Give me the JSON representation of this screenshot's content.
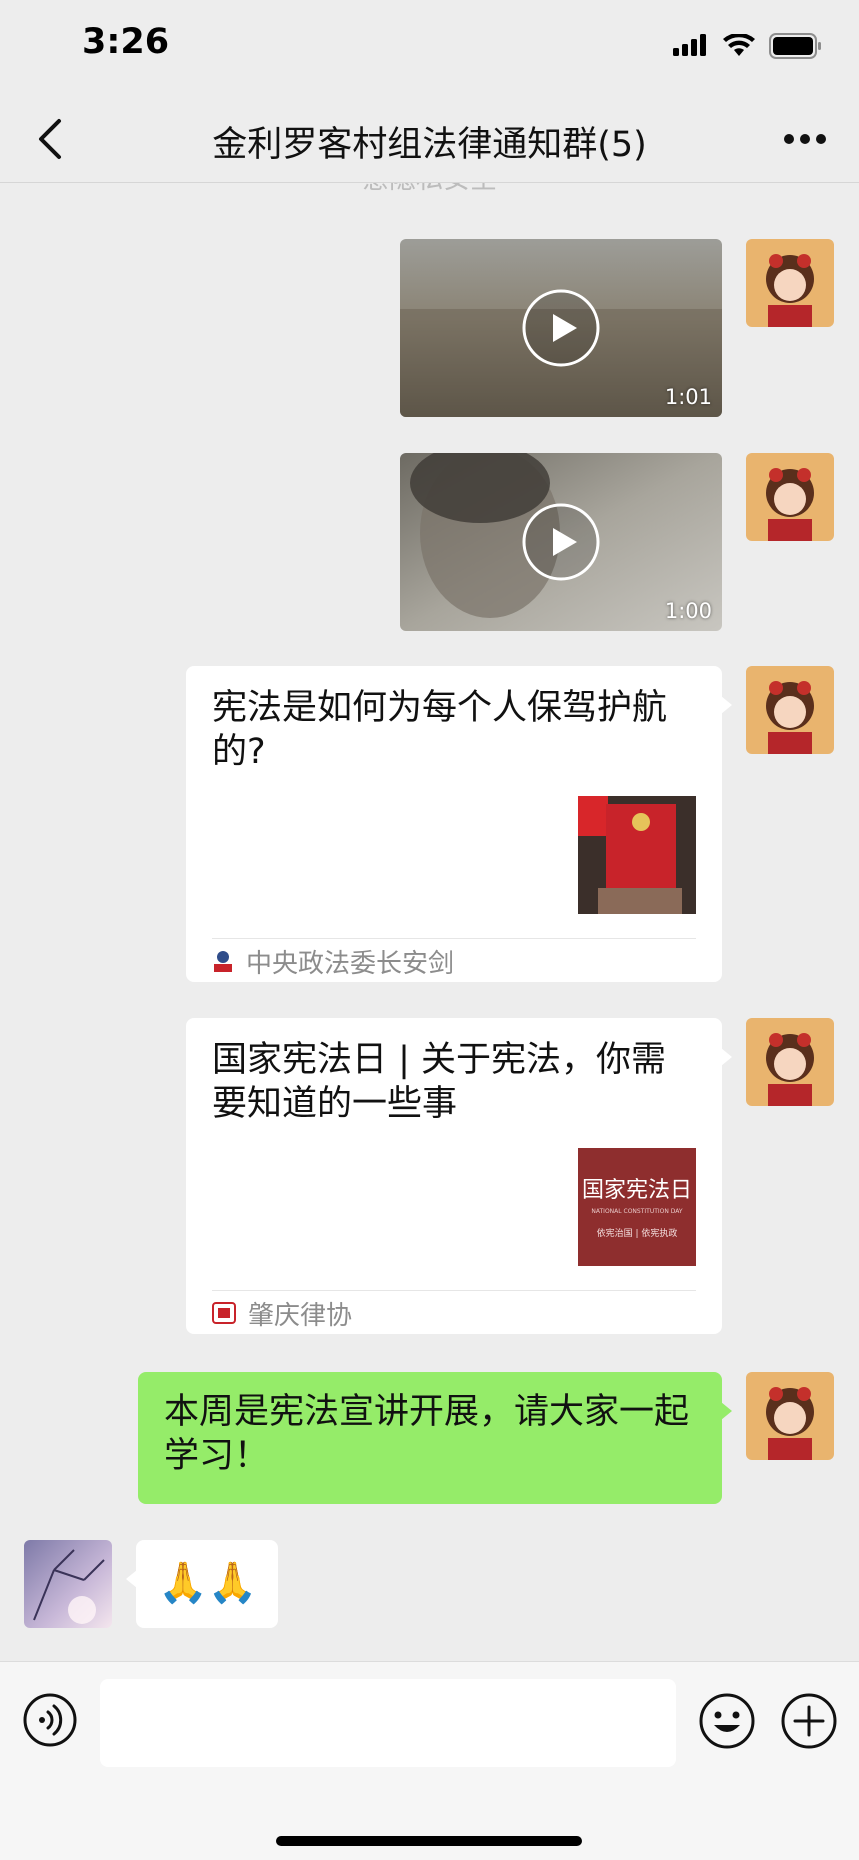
{
  "status_bar": {
    "time": "3:26"
  },
  "nav": {
    "title": "金利罗客村组法律通知群(5)"
  },
  "chat": {
    "partial_notice": "意隐私安全",
    "messages": [
      {
        "type": "video",
        "duration": "1:01"
      },
      {
        "type": "video",
        "duration": "1:00"
      },
      {
        "type": "article",
        "title": "宪法是如何为每个人保驾护航的?",
        "source": "中央政法委长安剑"
      },
      {
        "type": "article",
        "title": "国家宪法日 | 关于宪法，你需要知道的一些事",
        "source": "肇庆律协",
        "thumb_title": "国家宪法日",
        "thumb_subtitle": "NATIONAL CONSTITUTION DAY",
        "thumb_caption": "依宪治国 | 依宪执政"
      },
      {
        "type": "text",
        "text": "本周是宪法宣讲开展，请大家一起学习！"
      },
      {
        "type": "emoji",
        "text": "🙏🙏"
      }
    ]
  },
  "input_bar": {
    "placeholder": ""
  },
  "colors": {
    "background": "#ededed",
    "sent_bubble": "#95ec69",
    "card": "#ffffff",
    "muted_text": "#8c8c8c"
  },
  "icons": [
    "back-icon",
    "more-icon",
    "play-icon",
    "voice-icon",
    "emoji-icon",
    "plus-icon",
    "signal-icon",
    "wifi-icon",
    "battery-icon"
  ]
}
